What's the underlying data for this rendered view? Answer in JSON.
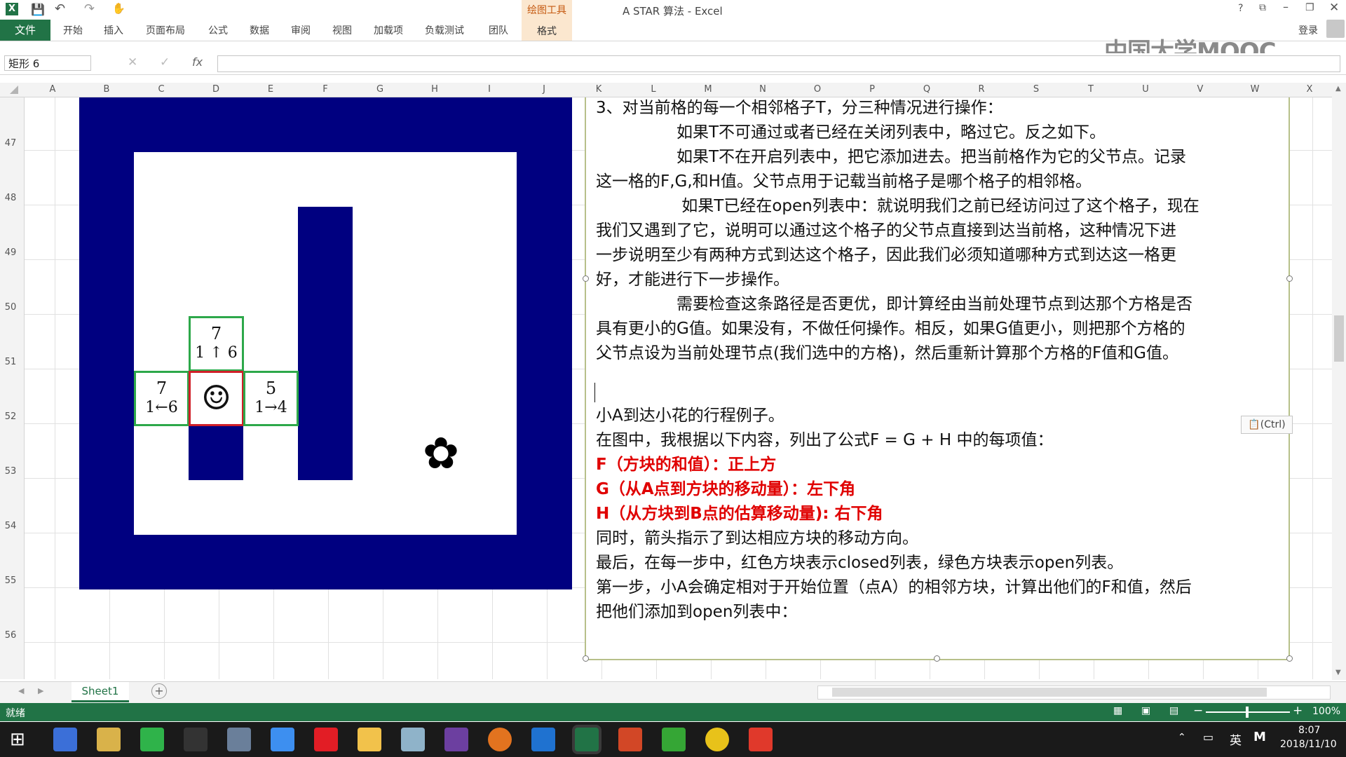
{
  "window": {
    "title": "A STAR 算法 - Excel",
    "help": "?",
    "login": "登录"
  },
  "ribbon": {
    "file": "文件",
    "tabs": [
      "开始",
      "插入",
      "页面布局",
      "公式",
      "数据",
      "审阅",
      "视图",
      "加载项",
      "负载测试",
      "团队"
    ],
    "drawing_tools": "绘图工具",
    "format": "格式"
  },
  "watermark": "中国大学MOOC",
  "formula": {
    "name_box": "矩形 6",
    "fx": "fx"
  },
  "columns": [
    "A",
    "B",
    "C",
    "D",
    "E",
    "F",
    "G",
    "H",
    "I",
    "J",
    "K",
    "L",
    "M",
    "N",
    "O",
    "P",
    "Q",
    "R",
    "S",
    "T",
    "U",
    "V",
    "W",
    "X"
  ],
  "rows": [
    "47",
    "48",
    "49",
    "50",
    "51",
    "52",
    "53",
    "54",
    "55",
    "56"
  ],
  "grid_cells": {
    "top": {
      "f": "7",
      "g": "1",
      "h": "6",
      "arrow": "↑"
    },
    "left": {
      "f": "7",
      "g": "1",
      "h": "6",
      "arrow": "←"
    },
    "right": {
      "f": "5",
      "g": "1",
      "h": "4",
      "arrow": "→"
    },
    "start_symbol": "☺",
    "goal_symbol": "✿"
  },
  "textbox": {
    "lines": [
      "3、对当前格的每一个相邻格子T，分三种情况进行操作：",
      "　　　　　如果T不可通过或者已经在关闭列表中，略过它。反之如下。",
      "　　　　　如果T不在开启列表中，把它添加进去。把当前格作为它的父节点。记录",
      "这一格的F,G,和H值。父节点用于记载当前格子是哪个格子的相邻格。",
      "　　　　　 如果T已经在open列表中：就说明我们之前已经访问过了这个格子，现在",
      "我们又遇到了它，说明可以通过这个格子的父节点直接到达当前格，这种情况下进",
      "一步说明至少有两种方式到达这个格子，因此我们必须知道哪种方式到达这一格更",
      "好，才能进行下一步操作。",
      "　　　　　需要检查这条路径是否更优，即计算经由当前处理节点到达那个方格是否",
      "具有更小的G值。如果没有，不做任何操作。相反，如果G值更小，则把那个方格的",
      "父节点设为当前处理节点(我们选中的方格)，然后重新计算那个方格的F值和G值。"
    ],
    "lines2": [
      "小A到达小花的行程例子。",
      "在图中，我根据以下内容，列出了公式F = G + H 中的每项值："
    ],
    "red_lines": [
      "F（方块的和值）：正上方",
      "G（从A点到方块的移动量）：左下角",
      "H（从方块到B点的估算移动量): 右下角"
    ],
    "lines3": [
      "同时，箭头指示了到达相应方块的移动方向。",
      "最后，在每一步中，红色方块表示closed列表，绿色方块表示open列表。"
    ],
    "lines4": [
      "第一步，小A会确定相对于开始位置（点A）的相邻方块，计算出他们的F和值，然后",
      "把他们添加到open列表中："
    ],
    "paste_tag": "(Ctrl)"
  },
  "sheet_tab": "Sheet1",
  "status": {
    "ready": "就绪",
    "zoom": "100%"
  },
  "tray": {
    "ime": "英",
    "time": "8:07",
    "date": "2018/11/10"
  },
  "colors": {
    "navy": "#000080",
    "excel_green": "#217346",
    "open_green": "#2da84a",
    "closed_red": "#d0202a"
  }
}
